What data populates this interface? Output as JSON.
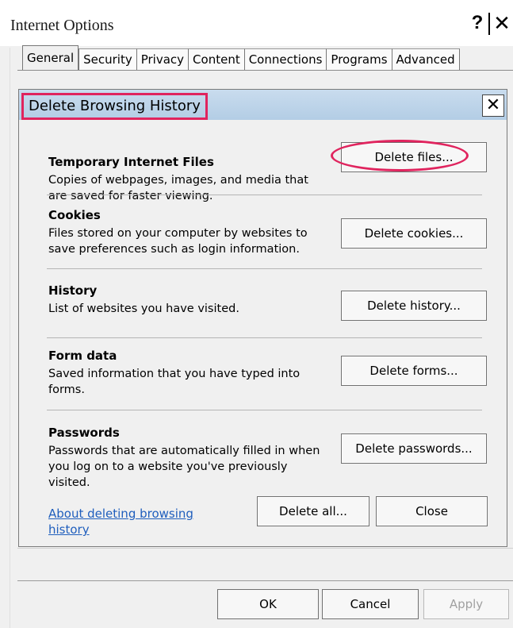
{
  "window": {
    "title": "Internet Options",
    "help_button": "?",
    "close_button": "✕"
  },
  "tabs": [
    {
      "label": "General",
      "active": true
    },
    {
      "label": "Security",
      "active": false
    },
    {
      "label": "Privacy",
      "active": false
    },
    {
      "label": "Content",
      "active": false
    },
    {
      "label": "Connections",
      "active": false
    },
    {
      "label": "Programs",
      "active": false
    },
    {
      "label": "Advanced",
      "active": false
    }
  ],
  "dialog": {
    "title": "Delete Browsing History",
    "close_button": "✕",
    "sections": [
      {
        "title": "Temporary Internet Files",
        "description": "Copies of webpages, images, and media that are saved for faster viewing.",
        "button": "Delete files..."
      },
      {
        "title": "Cookies",
        "description": "Files stored on your computer by websites to save preferences such as login information.",
        "button": "Delete cookies..."
      },
      {
        "title": "History",
        "description": "List of websites you have visited.",
        "button": "Delete history..."
      },
      {
        "title": "Form data",
        "description": "Saved information that you have typed into forms.",
        "button": "Delete forms..."
      },
      {
        "title": "Passwords",
        "description": "Passwords that are automatically filled in when you log on to a website you've previously visited.",
        "button": "Delete passwords..."
      }
    ],
    "about_link": "About deleting browsing history",
    "delete_all_button": "Delete all...",
    "close_dialog_button": "Close"
  },
  "footer": {
    "ok": "OK",
    "cancel": "Cancel",
    "apply": "Apply"
  },
  "colors": {
    "highlight": "#e0245e",
    "link": "#1f5ebd",
    "dialog_title_bg": "#b3cde5"
  }
}
